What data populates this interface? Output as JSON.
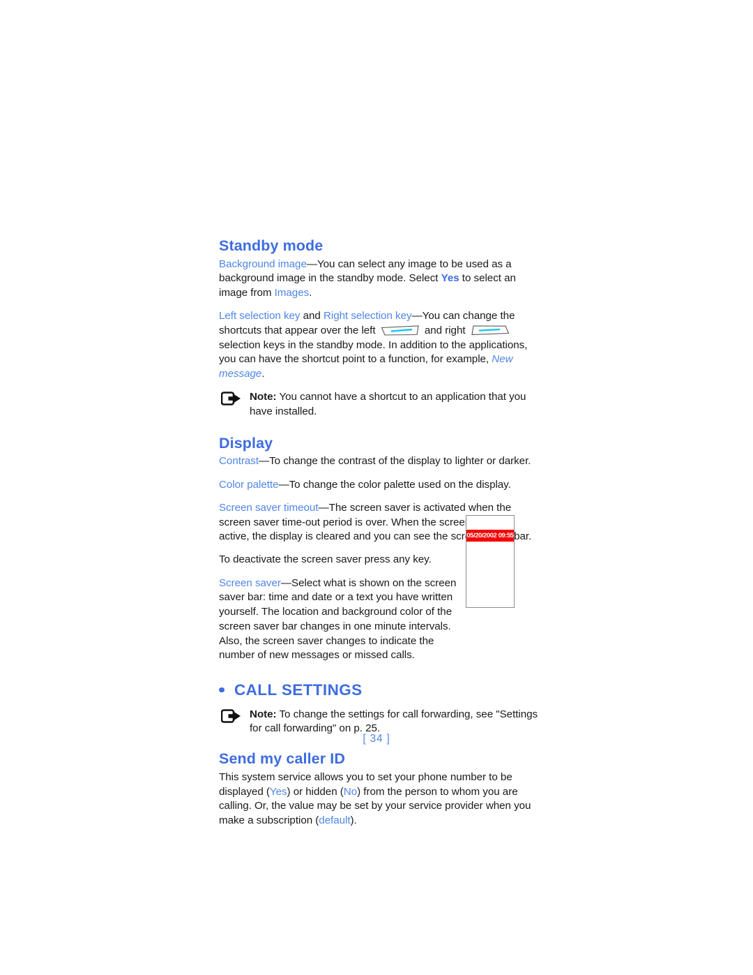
{
  "document": {
    "page_number": "[ 34 ]"
  },
  "standby": {
    "heading": "Standby mode",
    "p1": {
      "term": "Background image",
      "text_a": "—You can select any image to be used as a background image in the standby mode. Select ",
      "yes": "Yes",
      "text_b": " to select an image from ",
      "images": "Images",
      "text_c": "."
    },
    "p2": {
      "term_left": "Left selection key",
      "and": " and ",
      "term_right": "Right selection key",
      "text_a": "—You can change the shortcuts that appear over the left ",
      "text_b": " and right ",
      "text_c": " selection keys in the standby mode. In addition to the applications, you can have the shortcut point to a function, for example, ",
      "new_message": "New message",
      "text_d": "."
    },
    "note": {
      "label": "Note:",
      "text": " You cannot have a shortcut to an application that you have installed."
    }
  },
  "display": {
    "heading": "Display",
    "p1": {
      "term": "Contrast",
      "text": "—To change the contrast of the display to lighter or darker."
    },
    "p2": {
      "term": "Color palette",
      "text": "—To change the color palette used on the display."
    },
    "p3": {
      "term": "Screen saver timeout",
      "text": "—The screen saver is activated when the screen saver time-out period is over. When the screen saver is active, the display is cleared and you can see the screen saver bar."
    },
    "p4": "To deactivate the screen saver press any key.",
    "p5": {
      "term": "Screen saver",
      "text": "—Select what is shown on the screen saver bar: time and date or a text you have written yourself. The location and background color of the screen saver bar changes in one minute intervals. Also, the screen saver changes to indicate the number of new messages or missed calls."
    },
    "illustration": {
      "screensaver_bar_text": "05/20/2002 09:55",
      "bar_color": "#f40000"
    }
  },
  "call_settings": {
    "heading": "CALL SETTINGS",
    "note": {
      "label": "Note:",
      "text": " To change the settings for call forwarding, see \"Settings for call forwarding\" on p. 25."
    }
  },
  "caller_id": {
    "heading": "Send my caller ID",
    "p1": {
      "text_a": "This system service allows you to set your phone number to be displayed (",
      "yes": "Yes",
      "text_b": ") or hidden (",
      "no": "No",
      "text_c": ") from the person to whom you are calling. Or, the value may be set by your service provider when you make a subscription (",
      "default": "default",
      "text_d": ")."
    }
  },
  "colors": {
    "heading_blue": "#3e6ce0",
    "term_blue": "#4f86e8",
    "red_bar": "#f40000",
    "body_text": "#1a1a1a"
  }
}
